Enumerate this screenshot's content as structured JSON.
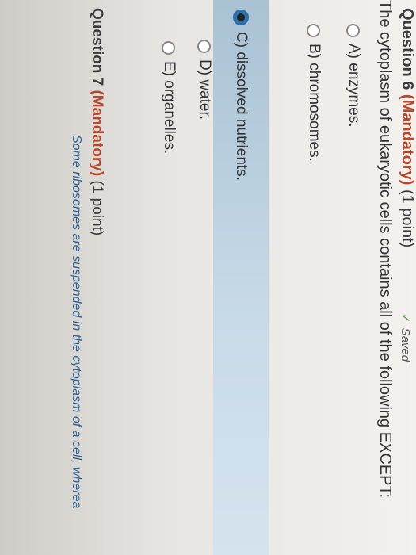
{
  "question6": {
    "number": "Question 6",
    "mandatory": "(Mandatory)",
    "points": "(1 point)",
    "saved": "Saved",
    "text": "The cytoplasm of eukaryotic cells contains all of the following EXCEPT:",
    "choices": [
      {
        "label": "A) enzymes.",
        "selected": false
      },
      {
        "label": "B) chromosomes.",
        "selected": false
      },
      {
        "label": "C) dissolved nutrients.",
        "selected": true
      },
      {
        "label": "D) water.",
        "selected": false
      },
      {
        "label": "E) organelles.",
        "selected": false
      }
    ]
  },
  "question7": {
    "number": "Question 7",
    "mandatory": "(Mandatory)",
    "points": "(1 point)",
    "text_partial": "Some ribosomes are suspended in the cytoplasm of a cell, wherea"
  },
  "colors": {
    "mandatory": "#b5482a",
    "selected_band": "#c9dbe8",
    "link_text": "#2d5f93"
  }
}
